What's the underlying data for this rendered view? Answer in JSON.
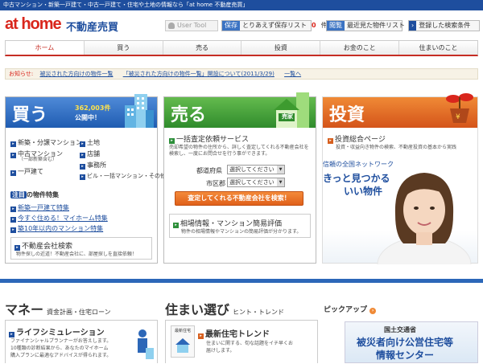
{
  "topbar": {
    "text": "中古マンション・新築一戸建て・中古一戸建て・住宅や土地の情報なら「at home 不動産売買」"
  },
  "header": {
    "logo": "at home",
    "site_title": "不動産売買",
    "user_tool": "User Tool",
    "save_tag": "保存",
    "save_label": "とりあえず保存リスト",
    "save_count": "0",
    "save_unit": "件",
    "history_tag": "閲覧",
    "history_label": "最近見た物件リスト",
    "registered_label": "登録した検索条件"
  },
  "nav": {
    "items": [
      "ホーム",
      "買う",
      "売る",
      "投資",
      "お金のこと",
      "住まいのこと"
    ]
  },
  "notice": {
    "label": "お知らせ:",
    "links": [
      "被災された方向けの物件一覧",
      "「被災された方向けの物件一覧」開設について(2011/3/29)",
      "一覧へ"
    ]
  },
  "buy": {
    "title": "買う",
    "count": "362,003件",
    "count_sub": "公開中！",
    "links": [
      "新築・分譲マンション",
      "中古マンション",
      "（一部新築含む）",
      "一戸建て",
      "土地",
      "店舗",
      "事務所",
      "ビル・一括マンション・その他"
    ],
    "feature_tag": "注目",
    "feature_title": "の物件特集",
    "feature_links": [
      "新築一戸建て特集",
      "今すぐ住める！マイホーム特集",
      "築10年以内のマンション特集"
    ],
    "company_title": "不動産会社検索",
    "company_desc": "物件探しの近道！不動産会社に、部屋探しを直接依頼！"
  },
  "sell": {
    "title": "売る",
    "badge": "売家",
    "service_title": "一括査定依頼サービス",
    "service_desc": "売却希望の物件の住所から、詳しく査定してくれる不動産会社を検索し、一度にお問合せを行う事ができます。",
    "pref_label": "都道府県",
    "pref_value": "選択してください",
    "city_label": "市区郡",
    "city_value": "選択してください",
    "search_button": "査定してくれる不動産会社を検索！",
    "price_title": "相場情報・マンション簡易評価",
    "price_desc": "物件の相場情報やマンションの簡易評価が分かります。"
  },
  "invest": {
    "title": "投資",
    "link": "投資総合ページ",
    "desc": "投資・収益向き物件の検索、不動産投資の基本から実践",
    "ad_small": "信頼の全国ネットワーク",
    "ad_big1": "きっと見つかる",
    "ad_big2": "いい物件"
  },
  "bottom": {
    "money_title": "マネー",
    "money_sub": "資金計画・住宅ローン",
    "money_item": "ライフシミュレーション",
    "money_desc1": "ファイナンシャルプランナーがお答えします。",
    "money_desc2": "10種類の診断結果から、あなたのマイホーム",
    "money_desc3": "購入プランに最適なアドバイスが得られます。",
    "home_title": "住まい選び",
    "home_sub": "ヒント・トレンド",
    "home_item": "最新住宅トレンド",
    "home_thumb": "最新住宅",
    "home_desc1": "住まいに関する、旬な話題をイチ早くお",
    "home_desc2": "届けします。",
    "pickup_title": "ピックアップ",
    "pickup_small": "国土交通省",
    "pickup_big1": "被災者向け公営住宅等",
    "pickup_big2": "情報センター"
  }
}
